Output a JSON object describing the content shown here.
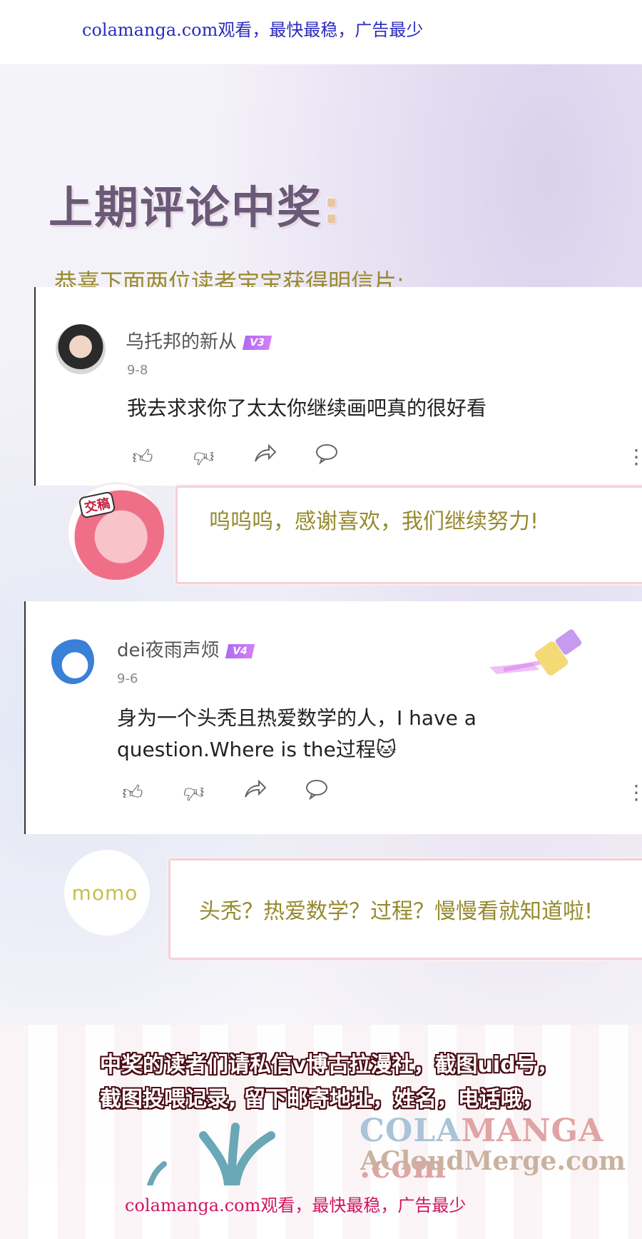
{
  "top_banner": "colamanga.com观看，最快最稳，广告最少",
  "bottom_banner": "colamanga.com观看，最快最稳，广告最少",
  "heading": "上期评论中奖",
  "heading_colon": ":",
  "subheading": "恭喜下面两位读者宝宝获得明信片:",
  "comments": [
    {
      "username": "乌托邦的新从",
      "badge": "V3",
      "date": "9-8",
      "text": "我去求求你了太太你继续画吧真的很好看"
    },
    {
      "username": "dei夜雨声烦",
      "badge": "V4",
      "date": "9-6",
      "text": "身为一个头秃且热爱数学的人，I have a question.Where is the过程🐱"
    }
  ],
  "actions": {
    "like_icon": "thumbs-up-icon",
    "dislike_icon": "thumbs-down-icon",
    "share_icon": "share-icon",
    "reply_icon": "comment-bubble-icon",
    "more_icon": "more-vertical-icon"
  },
  "replies": [
    {
      "author_tag": "交稿",
      "text": "呜呜呜，感谢喜欢，我们继续努力!"
    },
    {
      "author_tag": "momo",
      "text": "头秃？热爱数学？过程？慢慢看就知道啦!"
    }
  ],
  "notice_lines": [
    "中奖的读者们请私信v博古拉漫社，截图uid号，",
    "截图投喂记录, 留下邮寄地址，姓名，电话哦，"
  ],
  "watermark": {
    "line1_a": "COLA",
    "line1_b": "MANGA",
    "line1_c": " .com",
    "line2": "ACloudMerge.com"
  },
  "colors": {
    "top_banner": "#2b2bbf",
    "bottom_banner": "#d0155e",
    "reply_text": "#958a2e",
    "badge": "#b06bf0"
  }
}
